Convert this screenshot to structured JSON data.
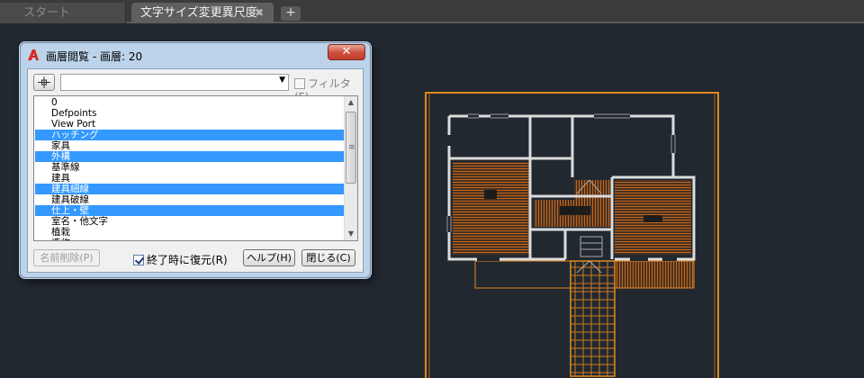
{
  "tabs": {
    "start_label": "スタート",
    "active_label": "文字サイズ変更異尺度",
    "close_glyph": "✖",
    "new_tab_glyph": "+"
  },
  "dialog": {
    "title": "画層閲覧 - 画層: 20",
    "close_glyph": "✕",
    "combo_value": "",
    "combo_arrow": "▼",
    "filter_label": "フィルタ(F)",
    "filter_checked": false,
    "layers": [
      {
        "name": "0",
        "selected": false
      },
      {
        "name": "Defpoints",
        "selected": false
      },
      {
        "name": "View Port",
        "selected": false
      },
      {
        "name": "ハッチング",
        "selected": true
      },
      {
        "name": "家具",
        "selected": false
      },
      {
        "name": "外構",
        "selected": true
      },
      {
        "name": "基準線",
        "selected": false
      },
      {
        "name": "建具",
        "selected": false
      },
      {
        "name": "建具細線",
        "selected": true
      },
      {
        "name": "建具破線",
        "selected": false
      },
      {
        "name": "仕上・壁",
        "selected": true
      },
      {
        "name": "室名・他文字",
        "selected": false
      },
      {
        "name": "植栽",
        "selected": false
      },
      {
        "name": "造作",
        "selected": false
      }
    ],
    "scroll_up_glyph": "▲",
    "scroll_down_glyph": "▼",
    "scroll_grip_glyph": "≡",
    "delete_label": "名前削除(P)",
    "restore_label": "終了時に復元(R)",
    "restore_checked": true,
    "help_label": "ヘルプ(H)",
    "close_label": "閉じる(C)"
  },
  "colors": {
    "background": "#212830",
    "wall": "#dcdcdc",
    "outline_orange": "#e08a1e",
    "hatch": "#b8601e",
    "selection": "#3399ff"
  },
  "icons": {
    "app": "autocad-a-icon",
    "pick": "layer-pick-icon"
  }
}
